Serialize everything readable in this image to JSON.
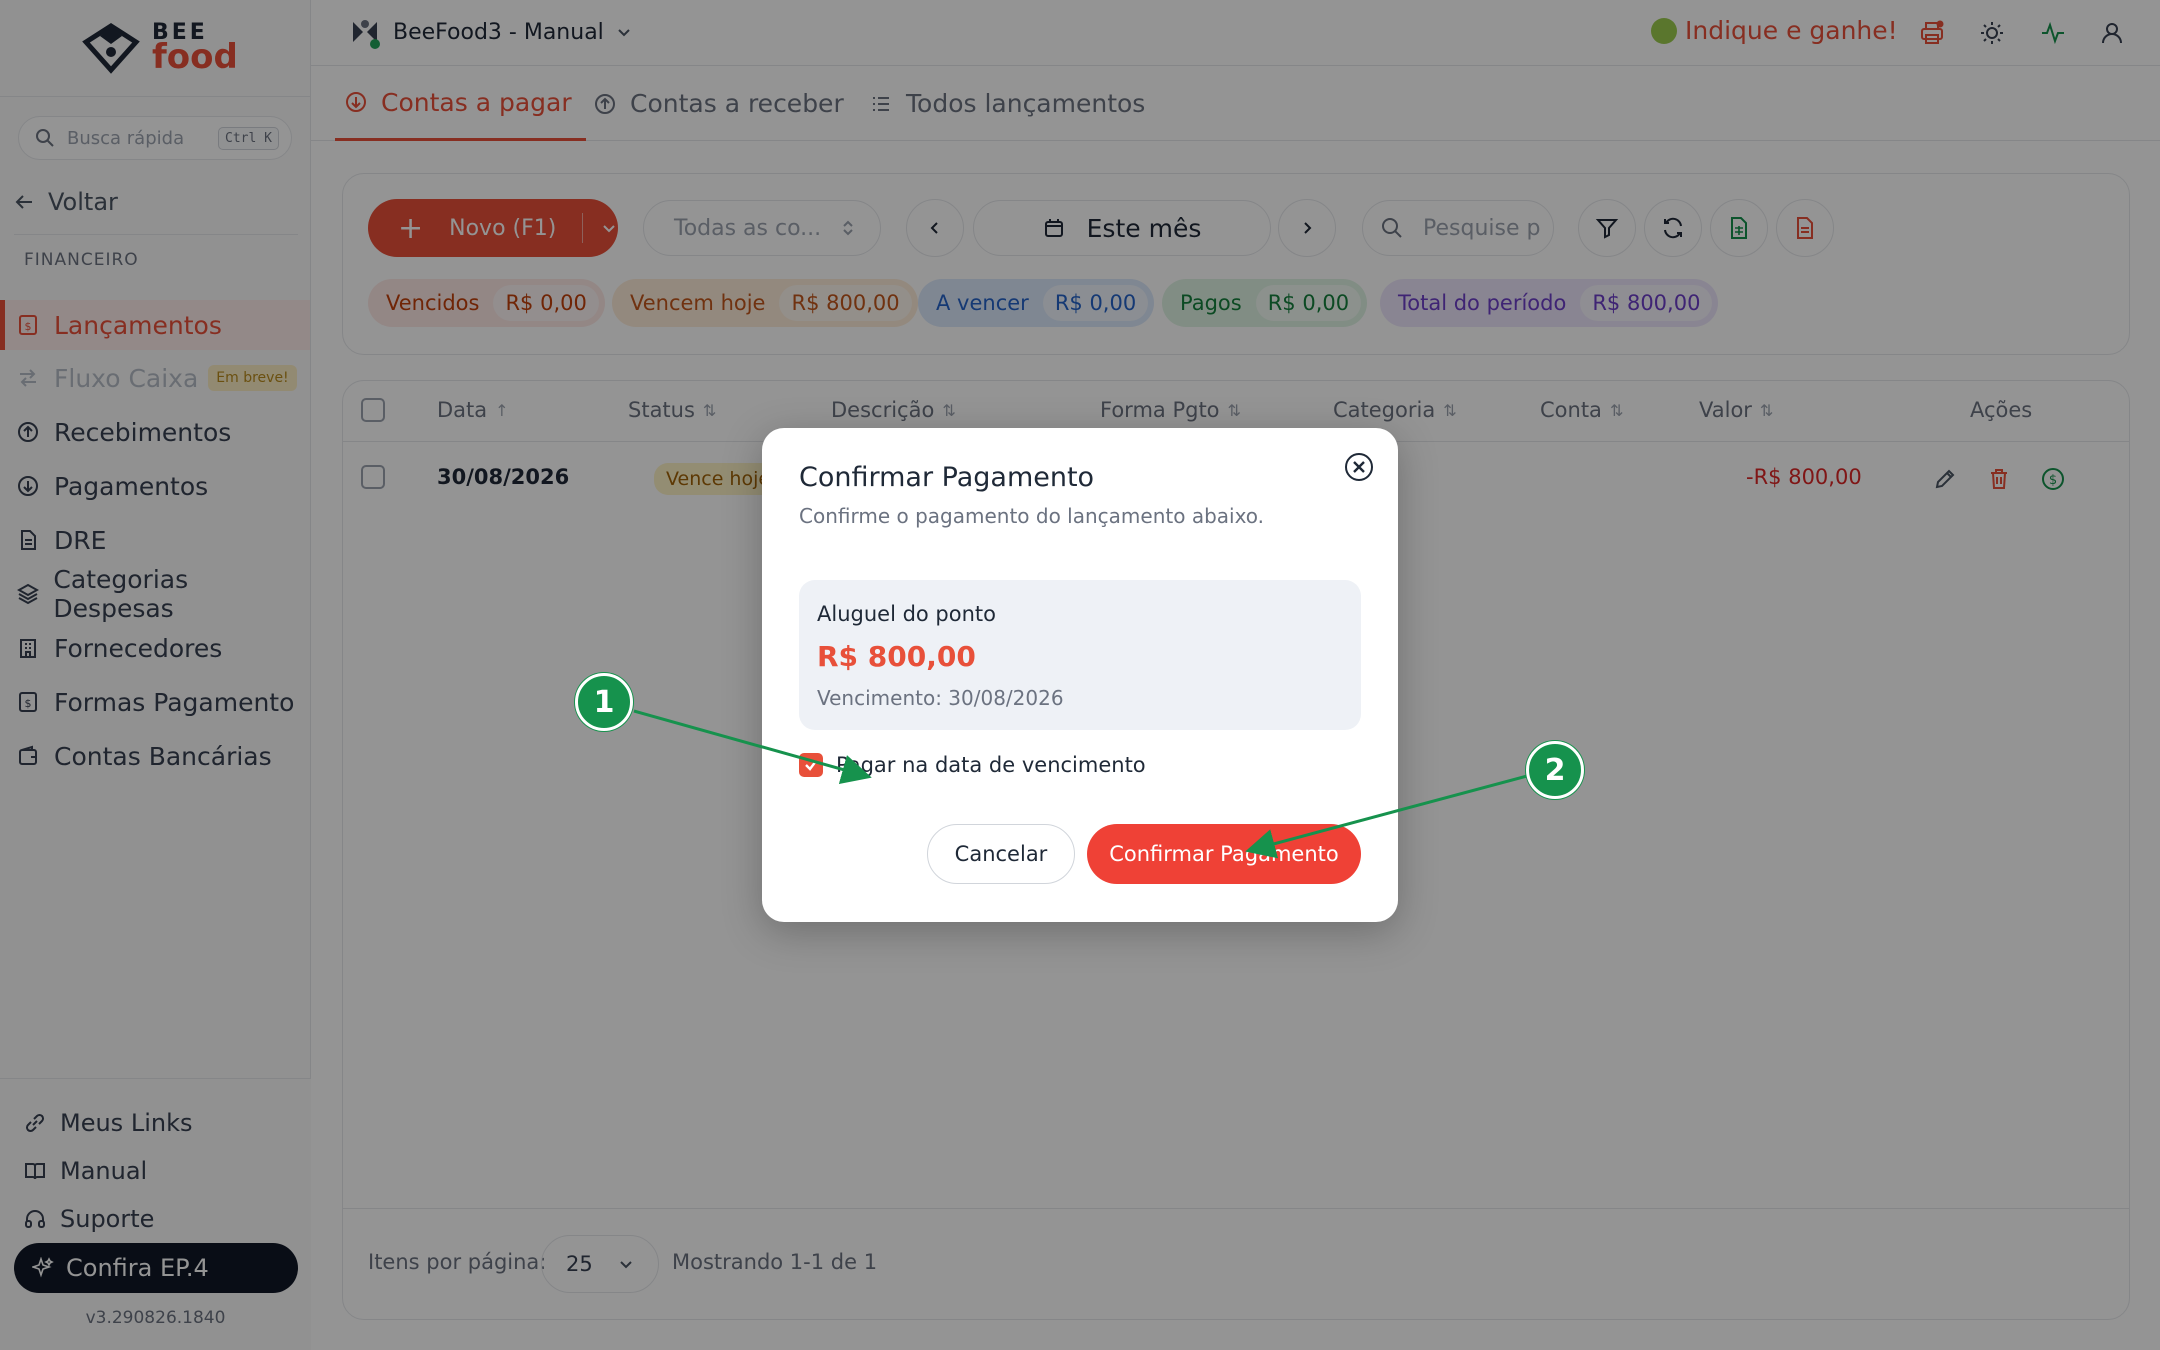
{
  "brand": {
    "logo_top": "BEE",
    "logo_bottom": "food"
  },
  "sidebar": {
    "quick_search_placeholder": "Busca rápida",
    "quick_search_shortcut": "Ctrl K",
    "back_label": "Voltar",
    "section_label": "FINANCEIRO",
    "items": [
      {
        "label": "Lançamentos",
        "icon": "receipt-icon"
      },
      {
        "label": "Fluxo Caixa",
        "icon": "arrows-swap-icon",
        "badge": "Em breve!"
      },
      {
        "label": "Recebimentos",
        "icon": "circle-arrow-up-icon"
      },
      {
        "label": "Pagamentos",
        "icon": "circle-arrow-down-icon"
      },
      {
        "label": "DRE",
        "icon": "document-icon"
      },
      {
        "label": "Categorias Despesas",
        "icon": "layers-icon"
      },
      {
        "label": "Fornecedores",
        "icon": "building-icon"
      },
      {
        "label": "Formas Pagamento",
        "icon": "receipt-icon"
      },
      {
        "label": "Contas Bancárias",
        "icon": "wallet-icon"
      }
    ],
    "bottom_links": [
      {
        "label": "Meus Links",
        "icon": "link-icon"
      },
      {
        "label": "Manual",
        "icon": "book-icon"
      },
      {
        "label": "Suporte",
        "icon": "headset-icon"
      }
    ],
    "promo_label": "Confira EP.4",
    "version": "v3.290826.1840"
  },
  "topbar": {
    "workspace": "BeeFood3 - Manual",
    "referral": "Indique e ganhe!"
  },
  "tabs": [
    {
      "label": "Contas a pagar"
    },
    {
      "label": "Contas a receber"
    },
    {
      "label": "Todos lançamentos"
    }
  ],
  "toolbar": {
    "new_label": "Novo (F1)",
    "accounts_select": "Todas as co...",
    "period": "Este mês",
    "search_placeholder": "Pesquise p"
  },
  "summary": [
    {
      "label": "Vencidos",
      "amount": "R$ 0,00",
      "color": "#fde8e6",
      "text": "#c2410c"
    },
    {
      "label": "Vencem hoje",
      "amount": "R$ 800,00",
      "color": "#fdecd9",
      "text": "#c2561c"
    },
    {
      "label": "A vencer",
      "amount": "R$ 0,00",
      "color": "#dbe8fb",
      "text": "#2563c9"
    },
    {
      "label": "Pagos",
      "amount": "R$ 0,00",
      "color": "#dff3e4",
      "text": "#15803d"
    },
    {
      "label": "Total do período",
      "amount": "R$ 800,00",
      "color": "#ece6fb",
      "text": "#6d3fc9"
    }
  ],
  "table": {
    "columns": [
      "Data",
      "Status",
      "Descrição",
      "Forma Pgto",
      "Categoria",
      "Conta",
      "Valor",
      "Ações"
    ],
    "rows": [
      {
        "date": "30/08/2026",
        "status": "Vence hoje",
        "value": "-R$ 800,00"
      }
    ]
  },
  "pagination": {
    "label": "Itens por página:",
    "per_page": "25",
    "info": "Mostrando 1-1 de 1"
  },
  "modal": {
    "title": "Confirmar Pagamento",
    "subtitle": "Confirme o pagamento do lançamento abaixo.",
    "description": "Aluguel do ponto",
    "amount": "R$ 800,00",
    "due": "Vencimento: 30/08/2026",
    "checkbox_label": "Pagar na data de vencimento",
    "cancel_label": "Cancelar",
    "confirm_label": "Confirmar Pagamento"
  },
  "annotations": [
    {
      "number": "1"
    },
    {
      "number": "2"
    }
  ],
  "colors": {
    "accent": "#e8503a",
    "callout": "#16924d"
  }
}
